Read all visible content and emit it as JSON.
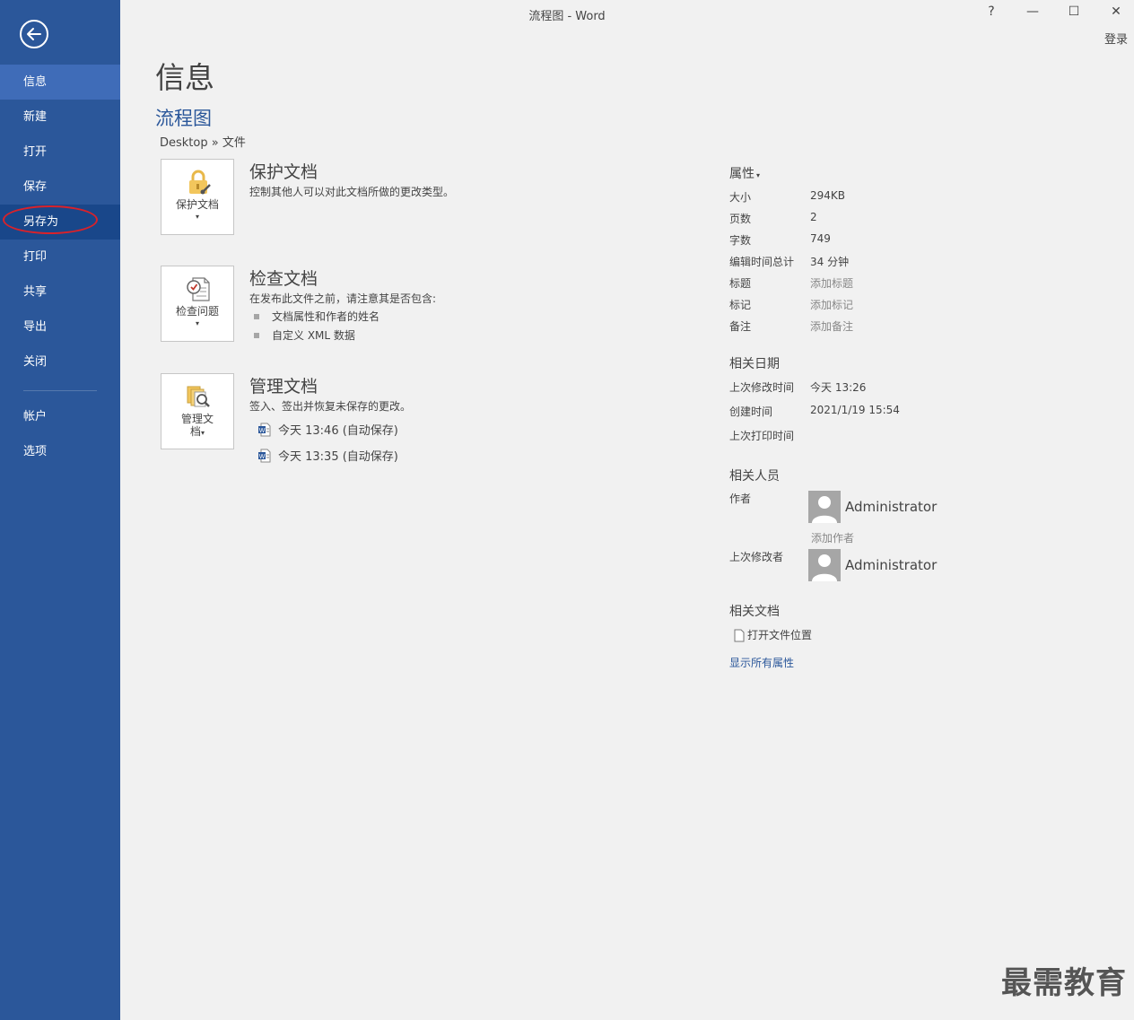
{
  "window": {
    "title": "流程图 - Word",
    "help": "?",
    "minimize": "—",
    "maximize": "☐",
    "close": "✕",
    "login": "登录"
  },
  "sidebar": {
    "items": [
      {
        "label": "信息"
      },
      {
        "label": "新建"
      },
      {
        "label": "打开"
      },
      {
        "label": "保存"
      },
      {
        "label": "另存为"
      },
      {
        "label": "打印"
      },
      {
        "label": "共享"
      },
      {
        "label": "导出"
      },
      {
        "label": "关闭"
      },
      {
        "label": "帐户"
      },
      {
        "label": "选项"
      }
    ]
  },
  "main": {
    "title": "信息",
    "doc_name": "流程图",
    "breadcrumb": "Desktop » 文件",
    "protect": {
      "button_label": "保护文档",
      "title": "保护文档",
      "desc": "控制其他人可以对此文档所做的更改类型。"
    },
    "inspect": {
      "button_label": "检查问题",
      "title": "检查文档",
      "desc": "在发布此文件之前，请注意其是否包含:",
      "bullets": [
        "文档属性和作者的姓名",
        "自定义 XML 数据"
      ]
    },
    "manage": {
      "button_label_1": "管理文",
      "button_label_2": "档",
      "title": "管理文档",
      "desc": "签入、签出并恢复未保存的更改。",
      "versions": [
        "今天 13:46 (自动保存)",
        "今天 13:35 (自动保存)"
      ]
    },
    "caret": "▾"
  },
  "properties": {
    "heading": "属性",
    "heading_caret": "▾",
    "rows": [
      {
        "label": "大小",
        "value": "294KB"
      },
      {
        "label": "页数",
        "value": "2"
      },
      {
        "label": "字数",
        "value": "749"
      },
      {
        "label": "编辑时间总计",
        "value": "34 分钟"
      },
      {
        "label": "标题",
        "value": "添加标题"
      },
      {
        "label": "标记",
        "value": "添加标记"
      },
      {
        "label": "备注",
        "value": "添加备注"
      }
    ]
  },
  "dates": {
    "heading": "相关日期",
    "rows": [
      {
        "label": "上次修改时间",
        "value": "今天 13:26"
      },
      {
        "label": "创建时间",
        "value": "2021/1/19 15:54"
      },
      {
        "label": "上次打印时间",
        "value": ""
      }
    ]
  },
  "people": {
    "heading": "相关人员",
    "author_label": "作者",
    "author_name": "Administrator",
    "add_author": "添加作者",
    "modifier_label": "上次修改者",
    "modifier_name": "Administrator"
  },
  "related_docs": {
    "heading": "相关文档",
    "open_location": "打开文件位置",
    "show_all": "显示所有属性"
  },
  "watermark": "最需教育",
  "colors": {
    "sidebar": "#2b579a",
    "selected": "#3f6cb8",
    "accent": "#2b579a",
    "ring": "#d9222a"
  }
}
